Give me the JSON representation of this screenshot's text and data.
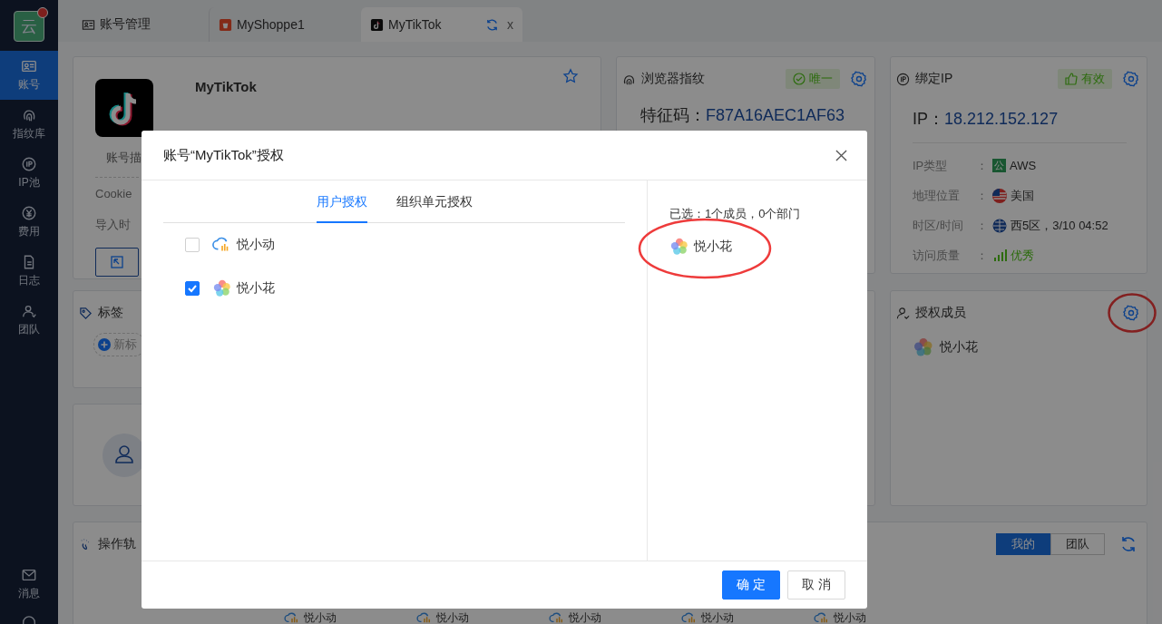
{
  "sidebar": {
    "logo": "云",
    "notification": true,
    "items": [
      {
        "label": "账号",
        "selected": true
      },
      {
        "label": "指纹库",
        "selected": false
      },
      {
        "label": "IP池",
        "selected": false
      },
      {
        "label": "费用",
        "selected": false
      },
      {
        "label": "日志",
        "selected": false
      },
      {
        "label": "团队",
        "selected": false
      }
    ],
    "bottom_items": [
      {
        "label": "消息"
      }
    ]
  },
  "tabs": [
    {
      "kind": "manager",
      "label": "账号管理",
      "selected": false
    },
    {
      "kind": "shop",
      "label": "MyShoppe1",
      "selected": false
    },
    {
      "kind": "tiktok",
      "label": "MyTikTok",
      "selected": true,
      "close": "x"
    }
  ],
  "profile": {
    "name": "MyTikTok",
    "description_label": "账号描",
    "cookie_label": "Cookie",
    "import_label": "导入时"
  },
  "fingerprint": {
    "title": "浏览器指纹",
    "badge": "唯一",
    "code_label": "特征码：",
    "code": "F87A16AEC1AF63"
  },
  "ip": {
    "title": "绑定IP",
    "badge": "有效",
    "ip_label": "IP：",
    "ip": "18.212.152.127",
    "rows": [
      {
        "kind": "type",
        "label": "IP类型",
        "colon": "：",
        "badge": "公",
        "value": "AWS"
      },
      {
        "kind": "location",
        "label": "地理位置",
        "colon": "：",
        "value": "美国"
      },
      {
        "kind": "timezone",
        "label": "时区/时间",
        "colon": "：",
        "value": "西5区，3/10 04:52"
      },
      {
        "kind": "quality",
        "label": "访问质量",
        "colon": "：",
        "value": "优秀"
      }
    ]
  },
  "tags": {
    "title": "标签",
    "add_label": "新标"
  },
  "auth_members": {
    "title": "授权成员",
    "gear_highlighted": true,
    "members": [
      {
        "name": "悦小花",
        "kind": "flower"
      }
    ]
  },
  "trail": {
    "title": "操作轨",
    "scope": [
      {
        "label": "我的",
        "selected": true
      },
      {
        "label": "团队",
        "selected": false
      }
    ],
    "items": [
      {
        "name": "悦小动"
      },
      {
        "name": "悦小动"
      },
      {
        "name": "悦小动"
      },
      {
        "name": "悦小动"
      },
      {
        "name": "悦小动"
      }
    ]
  },
  "dialog": {
    "title": "账号“MyTikTok”授权",
    "tabs": [
      {
        "label": "用户授权",
        "selected": true
      },
      {
        "label": "组织单元授权",
        "selected": false
      }
    ],
    "users": [
      {
        "name": "悦小动",
        "kind": "cloud",
        "checked": false
      },
      {
        "name": "悦小花",
        "kind": "flower",
        "checked": true
      }
    ],
    "summary": "已选：1个成员，0个部门",
    "selected_members": [
      {
        "name": "悦小花",
        "kind": "flower",
        "highlighted": true
      }
    ],
    "buttons": [
      {
        "label": "确 定",
        "kind": "primary"
      },
      {
        "label": "取 消",
        "kind": "default"
      }
    ]
  }
}
